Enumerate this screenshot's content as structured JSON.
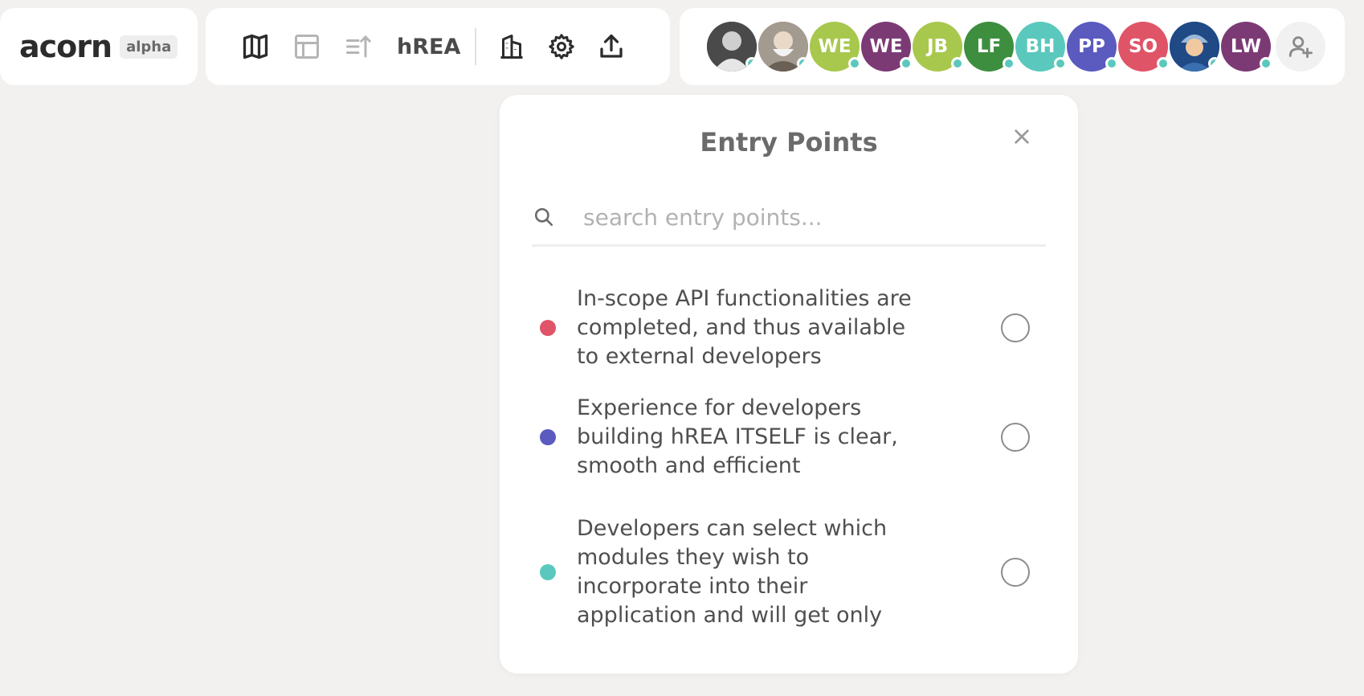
{
  "app": {
    "logo": "acorn",
    "badge": "alpha"
  },
  "nav": {
    "project_name": "hREA",
    "icons": [
      "map-icon",
      "table-icon",
      "priority-icon",
      "building-icon",
      "gear-icon",
      "upload-icon"
    ]
  },
  "members": [
    {
      "initials": "",
      "color": "#6e6e6e",
      "type": "photo"
    },
    {
      "initials": "",
      "color": "#9a8f86",
      "type": "photo"
    },
    {
      "initials": "WE",
      "color": "#a8c84d",
      "type": "initials"
    },
    {
      "initials": "WE",
      "color": "#7c3a75",
      "type": "initials"
    },
    {
      "initials": "JB",
      "color": "#a8c84d",
      "type": "initials"
    },
    {
      "initials": "LF",
      "color": "#3e8e3f",
      "type": "initials"
    },
    {
      "initials": "BH",
      "color": "#5bc8bd",
      "type": "initials"
    },
    {
      "initials": "PP",
      "color": "#5a5abf",
      "type": "initials"
    },
    {
      "initials": "SO",
      "color": "#e05467",
      "type": "initials"
    },
    {
      "initials": "",
      "color": "#2a5a9a",
      "type": "photo"
    },
    {
      "initials": "LW",
      "color": "#7c3a75",
      "type": "initials"
    }
  ],
  "modal": {
    "title": "Entry Points",
    "search": {
      "value": "",
      "placeholder": "search entry points..."
    },
    "entries": [
      {
        "text": "In-scope API functionalities are completed, and thus available to external developers",
        "color": "#e05467"
      },
      {
        "text": "Experience for developers building hREA ITSELF is clear, smooth and efficient",
        "color": "#5a5abf"
      },
      {
        "text": "Developers can select which modules they wish to incorporate into their application and will get only",
        "color": "#5bc8bd"
      }
    ]
  }
}
